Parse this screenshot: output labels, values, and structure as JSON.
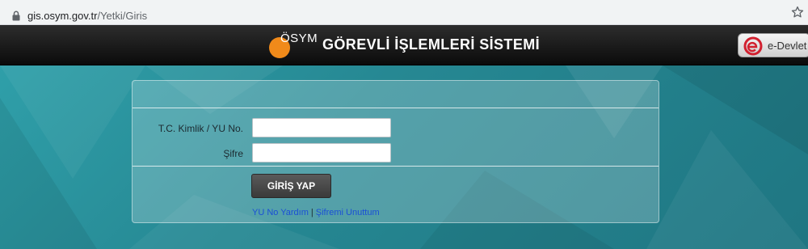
{
  "browser": {
    "url_host": "gis.osym.gov.tr",
    "url_path": "/Yetki/Giris",
    "icons": {
      "lock": "lock-icon",
      "bookmark": "star-icon"
    }
  },
  "header": {
    "logo_text": "ÖSYM",
    "title": "GÖREVLİ İŞLEMLERİ SİSTEMİ",
    "edevlet_label": "e-Devlet",
    "colors": {
      "bar": "#111111",
      "logo_orange": "#f08a1a",
      "edevlet_red": "#d2202f"
    }
  },
  "login": {
    "tc_label": "T.C. Kimlik / YU No.",
    "tc_value": "",
    "password_label": "Şifre",
    "password_value": "",
    "submit_label": "GİRİŞ YAP",
    "link_help": "YU No Yardım",
    "link_separator": "|",
    "link_forgot": "Şifremi Unuttum"
  },
  "theme": {
    "background": "#2a8f99",
    "link": "#1a4fd6"
  }
}
